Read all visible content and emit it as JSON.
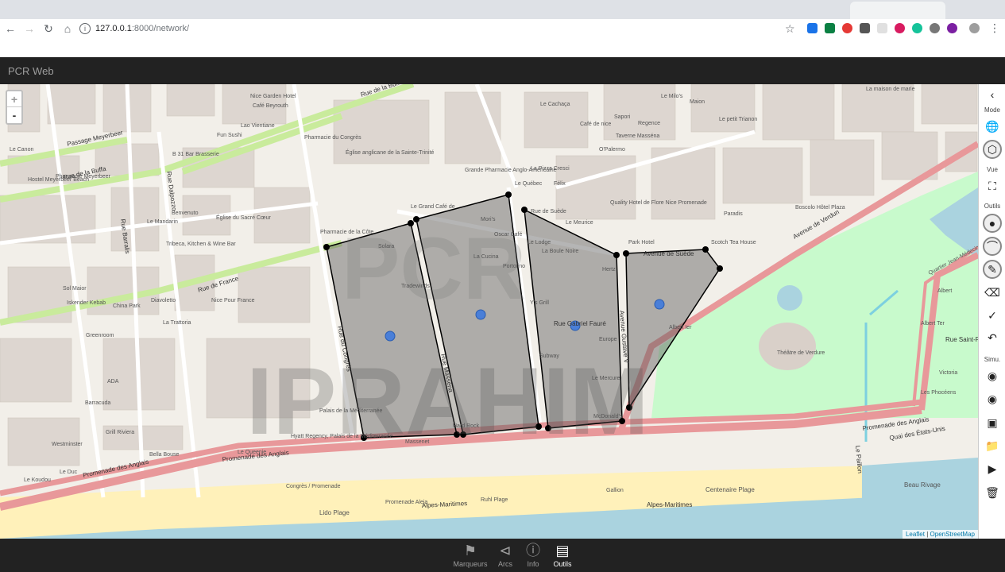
{
  "browser": {
    "url_host": "127.0.0.1",
    "url_rest": ":8000/network/",
    "icons": [
      "back-arrow",
      "forward-arrow",
      "reload",
      "home",
      "info",
      "star",
      "menu-dots"
    ]
  },
  "app": {
    "title": "PCR Web"
  },
  "map": {
    "zoom_in": "+",
    "zoom_out": "-",
    "attribution_leaflet": "Leaflet",
    "attribution_osm": "OpenStreetMap",
    "streets": {
      "buffa_top": "Rue de la Buffa",
      "buffa_left": "Rue de la Buffa",
      "meyerbeer": "Passage Meyerbeer",
      "france": "Rue de France",
      "verdun": "Avenue de Verdun",
      "anglais1": "Promenade des Anglais",
      "anglais2": "Promenade des Anglais",
      "anglais3": "Promenade des Anglais",
      "etats_unis": "Quai des États-Unis",
      "gustave": "Avenue Gustave V",
      "suede": "Avenue de Suède",
      "faure": "Rue Gabriel Fauré",
      "congres": "Rue du Congrès",
      "massena": "Rue Masséna",
      "dalpozzo": "Rue Dalpozzo",
      "barralis": "Rue Barralis",
      "alpes1": "Alpes-Maritimes",
      "alpes2": "Alpes-Maritimes",
      "st_francois": "Rue Saint-F",
      "paillon": "Le Paillon"
    },
    "places": {
      "nice_garden": "Nice Garden Hotel",
      "cafe_beyrouth": "Café Beyrouth",
      "lao": "Lao Vientiane",
      "fun_sushi": "Fun Sushi",
      "pharm_congres": "Pharmacie du Congrès",
      "eglise_trinite": "Église anglicane de la Sainte-Trinité",
      "le_canon": "Le Canon",
      "hotel_meyerbeer": "Hostel Meyerbeer Beach",
      "pharm_meyerbeer": "Pharmacie Meyerbeer",
      "b31": "B 31 Bar Brasserie",
      "benvenuto": "Benvenuto",
      "le_mandarin": "Le Mandarin",
      "eglise_coeur": "Église du Sacré Cœur",
      "pharm_cote": "Pharmacie de la Côte",
      "tribeca": "Tribeca, Kitchen & Wine Bar",
      "sol_maior": "Sol Maior",
      "china_park": "China Park",
      "diavoletto": "Diavoletto",
      "nice_pour_france": "Nice Pour France",
      "iskender": "Iskender Kebab",
      "la_trattoria": "La Trattoria",
      "greenroom": "Greenroom",
      "ada": "ADA",
      "barracuda": "Barracuda",
      "grill_riviera": "Grill Riviera",
      "westminster": "Westminster",
      "bellabouse": "Bella Bouse",
      "le_duc": "Le Duc",
      "le_koudou": "Le Koudou",
      "le_queenie": "Le Queenie",
      "hyatt": "Hyatt Regency, Palais de la Méditerranée",
      "palais_med": "Palais de la Méditerranée",
      "massenet": "Massenet",
      "hard_rock": "Hard Rock",
      "congres_promenade": "Congrès / Promenade",
      "lido": "Lido Plage",
      "promenade_aleja": "Promenade Aleja",
      "ruhl": "Ruhl Plage",
      "gallion": "Gallion",
      "centenaire": "Centenaire Plage",
      "beau_rivage": "Beau Rivage",
      "le_grand_cafe": "Le Grand Café de",
      "grande_pharmacie": "Grande Pharmacie Anglo-Américaine",
      "le_quebec": "Le Québec",
      "la_pizza": "La Pizza Cresci",
      "felix": "Félix",
      "cafe_nice": "Café de nice",
      "le_cachaca": "Le Cachaça",
      "sapori": "Sapori",
      "regence": "Regence",
      "taverne": "Taverne Masséna",
      "opalermo": "O'Palermo",
      "le_milos": "Le Milo's",
      "maion": "Maion",
      "le_petit_trianon": "Le petit Trianon",
      "la_maison_marie": "La maison de marie",
      "quality_hotel": "Quality Hotel de Flore Nice Promenade",
      "park_hotel": "Park Hotel",
      "scotch": "Scotch Tea House",
      "boscolo": "Boscolo Hôtel Plaza",
      "paradis": "Paradis",
      "le_meurice": "Le Meurice",
      "solara": "Solara",
      "la_cucina": "La Cucina",
      "tradewind": "Tradewinds",
      "oscar_cafe": "Oscar Café",
      "le_lodge": "Le Lodge",
      "la_boule": "La Boule Noire",
      "portofino": "Portofino",
      "ys_grill": "Y's Grill",
      "europe": "Europe",
      "hertz": "Hertz",
      "subway": "Subway",
      "le_mercure": "Le Mercure",
      "mcdonalds": "McDonald's",
      "theatre_verdure": "Théâtre de Verdure",
      "albert_i": "Albert Ier",
      "les_phoceens": "Les Phocéens",
      "albert_ter": "Albert Ter",
      "quartier": "Quartier Jean-Médecin",
      "amiral": "Albert",
      "victoria": "Victoria",
      "mori": "Mori's",
      "rue_suede": "Rue de Suède"
    },
    "watermark": "IPRAHIM"
  },
  "sidebar": {
    "collapse": "‹",
    "mode_label": "Mode",
    "vue_label": "Vue",
    "outils_label": "Outils",
    "simu_label": "Simu.",
    "icons": [
      "globe-icon",
      "polygon-icon",
      "fullscreen-icon",
      "marker-icon",
      "arc-icon",
      "pencil-icon",
      "eraser-icon",
      "check-icon",
      "undo-icon",
      "save-icon",
      "save-as-icon",
      "floppy-icon",
      "open-folder-icon",
      "play-icon",
      "trash-icon"
    ]
  },
  "bottom": {
    "tabs": [
      {
        "label": "Marqueurs",
        "icon": "marker-person-icon"
      },
      {
        "label": "Arcs",
        "icon": "share-nodes-icon"
      },
      {
        "label": "Info",
        "icon": "info-circle-icon"
      },
      {
        "label": "Outils",
        "icon": "ruler-icon"
      }
    ]
  }
}
